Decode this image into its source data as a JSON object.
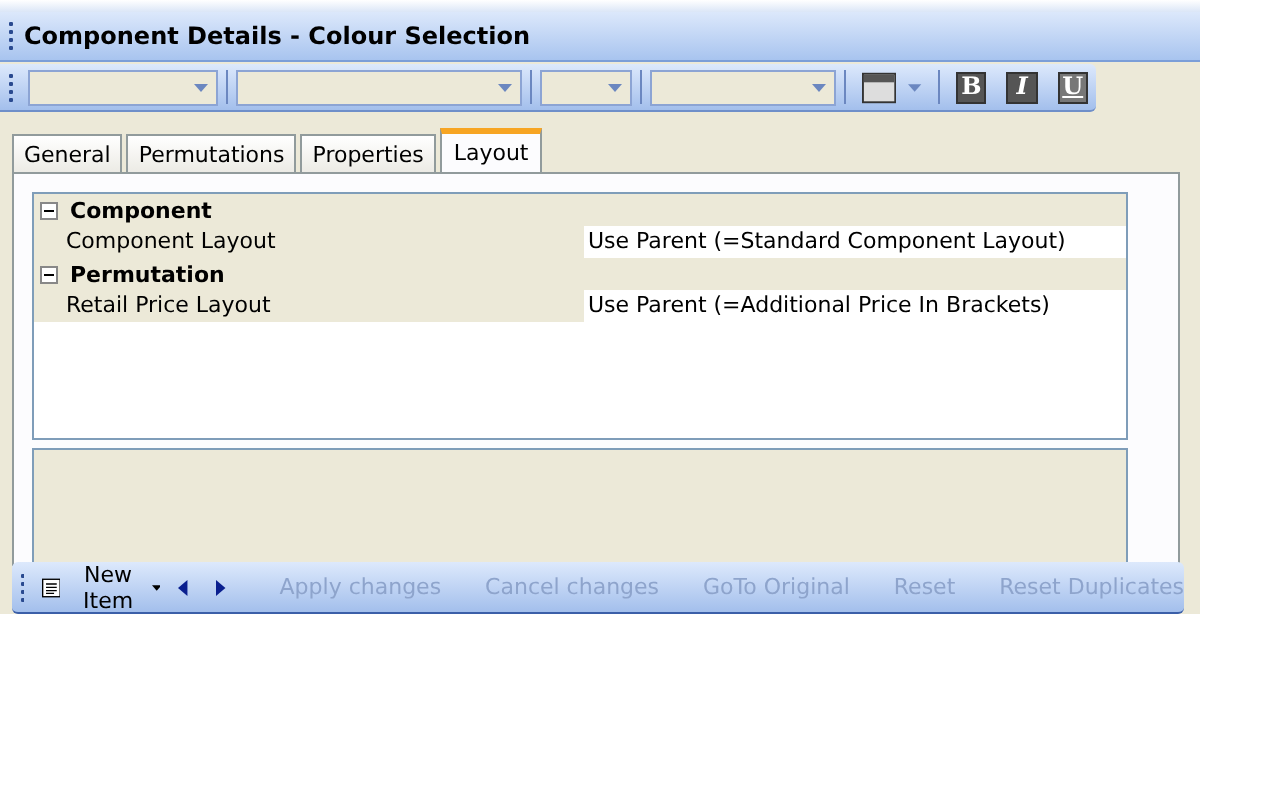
{
  "window": {
    "title": "Component Details - Colour Selection"
  },
  "toolbar": {
    "combos": [
      {
        "kind": "combo"
      },
      {
        "kind": "combo"
      },
      {
        "kind": "combo"
      },
      {
        "kind": "combo"
      }
    ],
    "format_buttons": [
      "B",
      "I",
      "U"
    ]
  },
  "tabs": [
    {
      "label": "General",
      "selected": false
    },
    {
      "label": "Permutations",
      "selected": false
    },
    {
      "label": "Properties",
      "selected": false
    },
    {
      "label": "Layout",
      "selected": true
    }
  ],
  "property_grid": {
    "categories": [
      {
        "name": "Component",
        "expanded": true,
        "properties": [
          {
            "name": "Component Layout",
            "value": "Use Parent (=Standard Component Layout)"
          }
        ]
      },
      {
        "name": "Permutation",
        "expanded": true,
        "properties": [
          {
            "name": "Retail Price Layout",
            "value": "Use Parent (=Additional Price In Brackets)"
          }
        ]
      }
    ]
  },
  "bottom_toolbar": {
    "new_item": "New Item",
    "actions": [
      {
        "label": "Apply changes",
        "disabled": true
      },
      {
        "label": "Cancel changes",
        "disabled": true
      },
      {
        "label": "GoTo Original",
        "disabled": true
      },
      {
        "label": "Reset",
        "disabled": true
      },
      {
        "label": "Reset Duplicates",
        "disabled": true
      }
    ]
  }
}
